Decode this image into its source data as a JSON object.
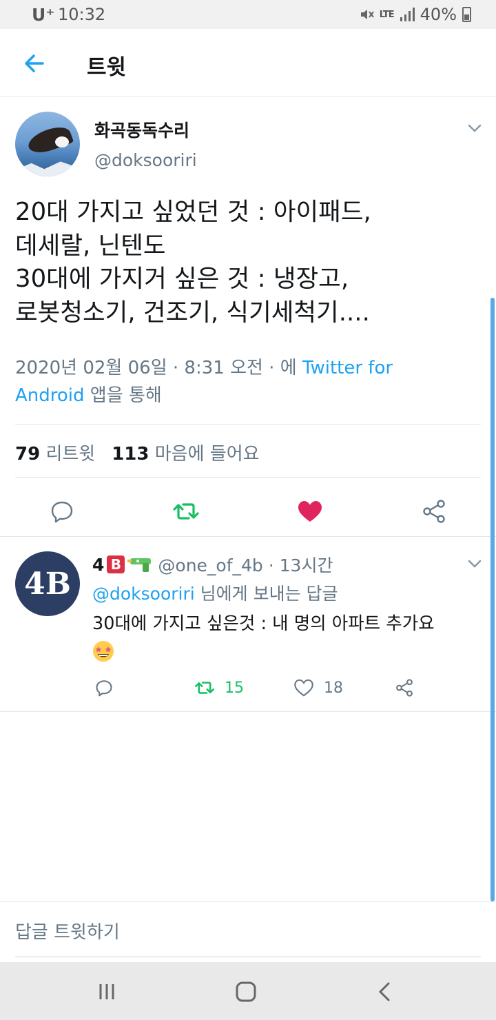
{
  "status_bar": {
    "carrier": "U⁺",
    "time": "10:32",
    "network": "LTE",
    "battery": "40%"
  },
  "header": {
    "title": "트윗",
    "back_icon": "back-arrow-icon"
  },
  "tweet": {
    "display_name": "화곡동독수리",
    "handle": "@doksooriri",
    "text": "20대 가지고 싶었던 것 : 아이패드,\n데세랄, 닌텐도\n30대에 가지거 싶은 것 : 냉장고,\n로봇청소기, 건조기, 식기세척기....",
    "meta_prefix": "2020년 02월 06일 · 8:31 오전 · 에 ",
    "meta_source": "Twitter for Android",
    "meta_suffix": " 앱을 통해",
    "retweet_count": "79",
    "retweet_label": "리트윗",
    "like_count": "113",
    "like_label": "마음에 들어요",
    "liked": true
  },
  "reply": {
    "display_name": "4",
    "badge": "B",
    "handle_time": "@one_of_4b · 13시간",
    "reply_to_handle": "@doksooriri",
    "reply_to_suffix": " 님에게 보내는 답글",
    "text": "30대에 가지고 싶은것 : 내 명의 아파트 추가요",
    "retweet_count": "15",
    "like_count": "18",
    "avatar_text": "4B"
  },
  "composer": {
    "placeholder": "답글 트윗하기"
  },
  "colors": {
    "accent": "#1da1f2",
    "retweet": "#17bf63",
    "like": "#e0245e",
    "text": "#14171a",
    "secondary": "#657786"
  }
}
